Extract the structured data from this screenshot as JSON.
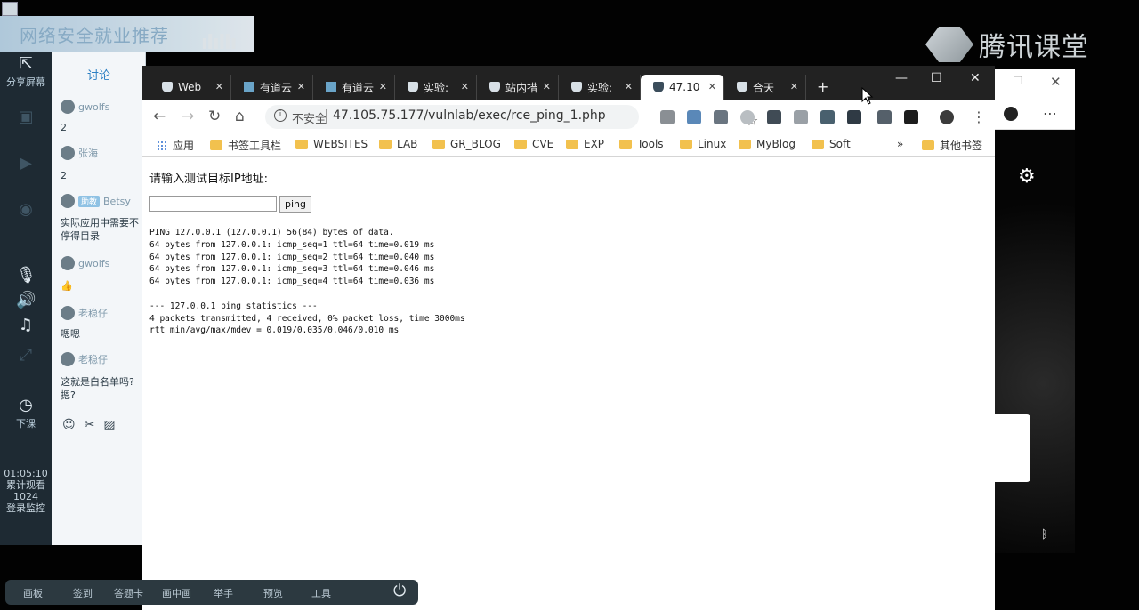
{
  "overlay": {
    "banner_text": "网络安全就业推荐",
    "brand_logo": "腾讯课堂"
  },
  "left_strip": {
    "share_label": "分享屏幕",
    "end_class_label": "下课",
    "timer": "01:05:10",
    "viewers_label": "累计观看",
    "viewers_count": "1024",
    "monitor_label": "登录监控"
  },
  "chat": {
    "tab_label": "讨论",
    "messages": [
      {
        "name": "gwolfs",
        "text": "2"
      },
      {
        "name": "张海",
        "text": "2"
      },
      {
        "name": "Betsy",
        "tag": "助教",
        "text": "实际应用中需要不停得目录"
      },
      {
        "name": "gwolfs",
        "text": "👍"
      },
      {
        "name": "老稳仔",
        "text": "嗯嗯"
      },
      {
        "name": "老稳仔",
        "text": "这就是白名单吗?\n摁?"
      }
    ]
  },
  "browser": {
    "tabs": [
      {
        "label": "Web",
        "icon": "shield-icon"
      },
      {
        "label": "有道云",
        "icon": "doc-icon"
      },
      {
        "label": "有道云",
        "icon": "doc-icon"
      },
      {
        "label": "实验:",
        "icon": "shield-icon"
      },
      {
        "label": "站内措",
        "icon": "shield-icon"
      },
      {
        "label": "实验:",
        "icon": "shield-icon"
      },
      {
        "label": "47.10",
        "icon": "shield-icon",
        "active": true
      },
      {
        "label": "合天",
        "icon": "shield-icon"
      }
    ],
    "address": {
      "insecure_label": "不安全",
      "url": "47.105.75.177/vulnlab/exec/rce_ping_1.php"
    },
    "bookmarks": [
      {
        "label": "应用",
        "icon": "apps-icon"
      },
      {
        "label": "书签工具栏"
      },
      {
        "label": "WEBSITES"
      },
      {
        "label": "LAB"
      },
      {
        "label": "GR_BLOG"
      },
      {
        "label": "CVE"
      },
      {
        "label": "EXP"
      },
      {
        "label": "Tools"
      },
      {
        "label": "Linux"
      },
      {
        "label": "MyBlog"
      },
      {
        "label": "Soft"
      }
    ],
    "bookmarks_more": "»",
    "other_bookmarks": "其他书签"
  },
  "page": {
    "prompt": "请输入测试目标IP地址:",
    "input_value": "",
    "ping_button": "ping",
    "output": "PING 127.0.0.1 (127.0.0.1) 56(84) bytes of data.\n64 bytes from 127.0.0.1: icmp_seq=1 ttl=64 time=0.019 ms\n64 bytes from 127.0.0.1: icmp_seq=2 ttl=64 time=0.040 ms\n64 bytes from 127.0.0.1: icmp_seq=3 ttl=64 time=0.046 ms\n64 bytes from 127.0.0.1: icmp_seq=4 ttl=64 time=0.036 ms\n\n--- 127.0.0.1 ping statistics ---\n4 packets transmitted, 4 received, 0% packet loss, time 3000ms\nrtt min/avg/max/mdev = 0.019/0.035/0.046/0.010 ms"
  },
  "bottom_toolbar": [
    "画板",
    "签到",
    "答题卡",
    "画中画",
    "举手",
    "预览",
    "工具"
  ]
}
